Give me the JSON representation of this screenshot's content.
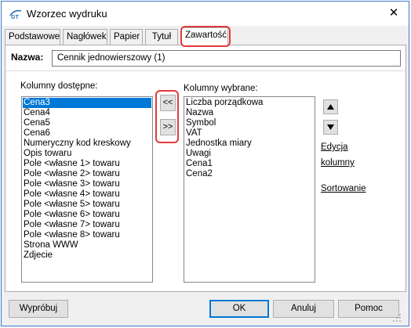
{
  "window": {
    "title": "Wzorzec wydruku",
    "close_glyph": "✕",
    "icon": "app-icon"
  },
  "tabs": [
    {
      "label": "Podstawowe",
      "active": false
    },
    {
      "label": "Nagłówek",
      "active": false
    },
    {
      "label": "Papier",
      "active": false
    },
    {
      "label": "Tytuł",
      "active": false
    },
    {
      "label": "Zawartość",
      "active": true
    }
  ],
  "name": {
    "label": "Nazwa:",
    "value": "Cennik jednowierszowy (1)"
  },
  "available": {
    "label": "Kolumny dostępne:",
    "items": [
      "Cena3",
      "Cena4",
      "Cena5",
      "Cena6",
      "Numeryczny kod kreskowy",
      "Opis towaru",
      "Pole <własne 1> towaru",
      "Pole <własne 2> towaru",
      "Pole <własne 3> towaru",
      "Pole <własne 4> towaru",
      "Pole <własne 5> towaru",
      "Pole <własne 6> towaru",
      "Pole <własne 7> towaru",
      "Pole <własne 8> towaru",
      "Strona WWW",
      "Zdjecie"
    ],
    "selected": "Cena3"
  },
  "transfer": {
    "add_all_label": "<<",
    "remove_label": ">>"
  },
  "chosen": {
    "label": "Kolumny wybrane:",
    "items": [
      "Liczba porządkowa",
      "Nazwa",
      "Symbol",
      "VAT",
      "Jednostka miary",
      "Uwagi",
      "Cena1",
      "Cena2"
    ]
  },
  "side": {
    "up_icon": "triangle-up-icon",
    "down_icon": "triangle-down-icon",
    "edit_line1": "Edycja",
    "edit_line2": "kolumny",
    "sort_label": "Sortowanie"
  },
  "buttons": {
    "try": "Wypróbuj",
    "ok": "OK",
    "cancel": "Anuluj",
    "help": "Pomoc"
  },
  "colors": {
    "highlight": "#e23b3b",
    "selection": "#0078d7"
  }
}
